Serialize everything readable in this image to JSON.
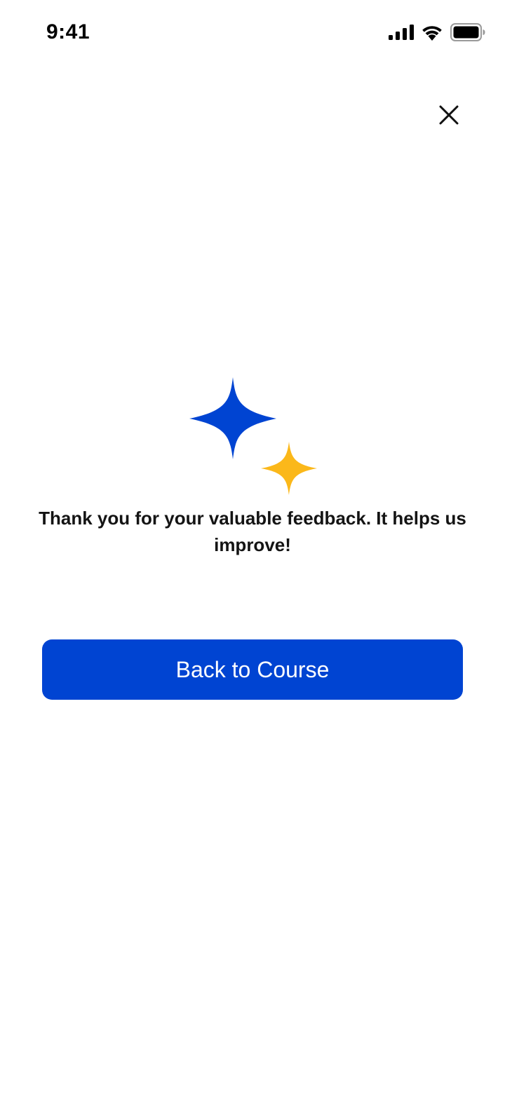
{
  "status_bar": {
    "time": "9:41",
    "icons": [
      "cellular-signal-icon",
      "wifi-icon",
      "battery-icon"
    ]
  },
  "header": {
    "close_icon": "close-icon"
  },
  "illustration": {
    "icons": [
      "sparkle-large-icon",
      "sparkle-small-icon"
    ],
    "colors": {
      "large_sparkle": "#0044D2",
      "small_sparkle": "#FBB81A"
    }
  },
  "content": {
    "message": "Thank you for your valuable feedback. It helps us improve!"
  },
  "actions": {
    "back_label": "Back to Course"
  },
  "colors": {
    "accent": "#0044D2",
    "background": "#FFFFFF",
    "text": "#141414"
  }
}
